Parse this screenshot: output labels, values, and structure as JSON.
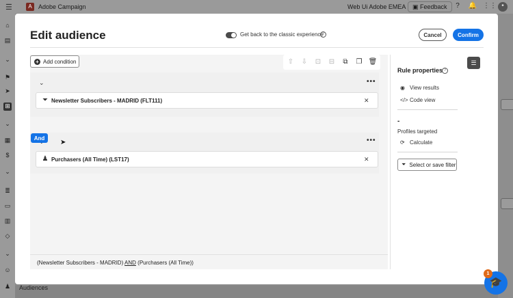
{
  "app": {
    "title": "Adobe Campaign",
    "org": "Web Ui Adobe EMEA",
    "feedback_label": "Feedback",
    "logo_icon": "adobe-logo-icon",
    "nav_bottom_label": "Audiences"
  },
  "modal": {
    "title": "Edit audience",
    "classic_toggle_label": "Get back to the classic experience",
    "cancel_label": "Cancel",
    "confirm_label": "Confirm"
  },
  "canvas": {
    "add_condition_label": "Add condition",
    "toolbar_icons": [
      "arrow-up-icon",
      "arrow-down-icon",
      "group-icon",
      "ungroup-icon",
      "copy-icon",
      "duplicate-icon",
      "delete-icon"
    ],
    "groups": [
      {
        "condition_label": "Newsletter Subscribers - MADRID (FLT111)",
        "icon": "filter-icon"
      },
      {
        "condition_label": "Purchasers (All Time) (LST17)",
        "icon": "audience-icon"
      }
    ],
    "operator_label": "And",
    "summary": {
      "part1": "(Newsletter Subscribers - MADRID)",
      "operator": "AND",
      "part2": "(Purchasers (All Time))"
    }
  },
  "rule_properties": {
    "title": "Rule properties",
    "view_results_label": "View results",
    "code_view_label": "Code view",
    "profiles_value": "-",
    "profiles_label": "Profiles targeted",
    "calculate_label": "Calculate",
    "filter_button_label": "Select or save filter"
  },
  "help": {
    "badge_count": "1"
  },
  "colors": {
    "accent": "#1473e6",
    "badge": "#e06b1a"
  }
}
